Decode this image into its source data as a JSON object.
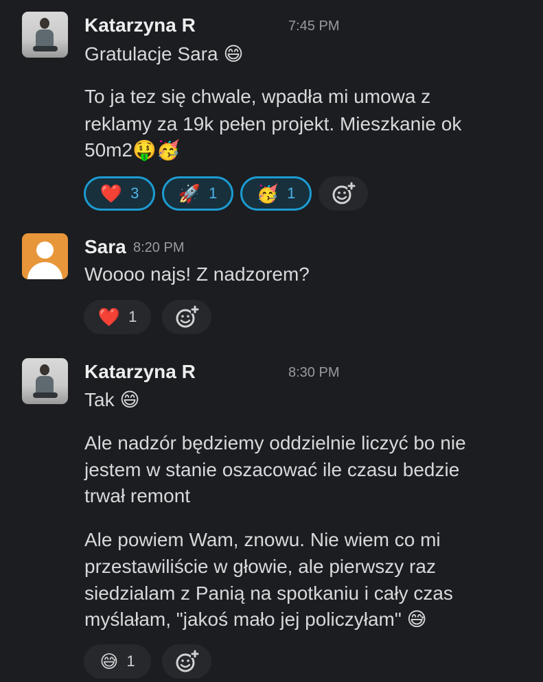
{
  "messages": [
    {
      "author": "Katarzyna R",
      "time": "7:45 PM",
      "lines": [
        "Gratulacje Sara 😄",
        "To ja tez się chwale, wpadła mi umowa z",
        "reklamy za 19k pełen projekt. Mieszkanie ok",
        "50m2🤑🥳"
      ],
      "reactions": [
        {
          "emoji": "❤️",
          "count": "3"
        },
        {
          "emoji": "🚀",
          "count": "1"
        },
        {
          "emoji": "🥳",
          "count": "1"
        }
      ]
    },
    {
      "author": "Sara",
      "time": "8:20 PM",
      "lines": [
        "Woooo najs! Z nadzorem?"
      ],
      "reactions": [
        {
          "emoji": "❤️",
          "count": "1"
        }
      ]
    },
    {
      "author": "Katarzyna R",
      "time": "8:30 PM",
      "lines": [
        "Tak 😄",
        "Ale nadzór będziemy oddzielnie liczyć bo nie",
        "jestem w stanie oszacować ile czasu bedzie",
        "trwał remont",
        "Ale powiem Wam, znowu. Nie wiem co mi",
        "przestawiliście w głowie, ale pierwszy raz",
        "siedzialam z Panią na spotkaniu i cały czas",
        "myślałam, \"jakoś mało jej policzyłam\" 😅"
      ],
      "reactions": [
        {
          "emoji": "😅",
          "count": "1"
        }
      ]
    }
  ],
  "icons": {
    "add_reaction": "add-reaction-icon"
  },
  "colors": {
    "background": "#1b1d21",
    "active_reaction_border": "#1d9bd1",
    "sara_avatar": "#e8963a"
  }
}
